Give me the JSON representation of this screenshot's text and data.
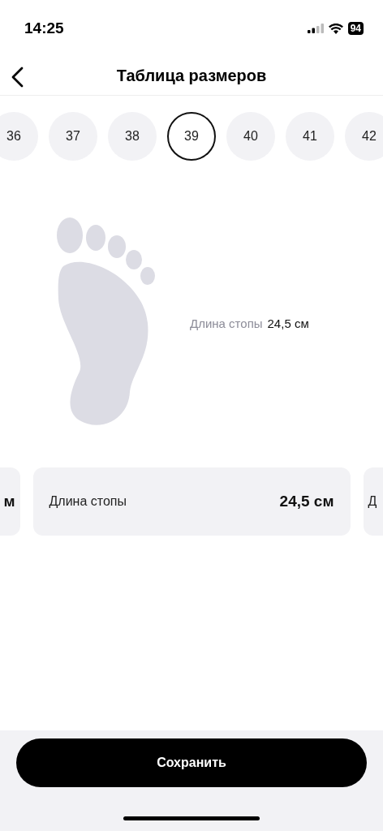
{
  "status_bar": {
    "time": "14:25",
    "battery": "94"
  },
  "header": {
    "title": "Таблица размеров"
  },
  "sizes": [
    {
      "label": "36",
      "selected": false
    },
    {
      "label": "37",
      "selected": false
    },
    {
      "label": "38",
      "selected": false
    },
    {
      "label": "39",
      "selected": true
    },
    {
      "label": "40",
      "selected": false
    },
    {
      "label": "41",
      "selected": false
    },
    {
      "label": "42",
      "selected": false
    }
  ],
  "foot": {
    "label": "Длина стопы",
    "value": "24,5 см"
  },
  "cards": [
    {
      "value": "м"
    },
    {
      "label": "Длина стопы",
      "value": "24,5 см"
    },
    {
      "label": "Д"
    }
  ],
  "save_button": "Сохранить"
}
